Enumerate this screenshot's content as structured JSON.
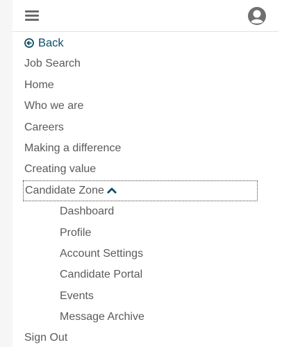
{
  "header": {
    "menu_icon": "hamburger-menu-icon",
    "user_icon": "user-avatar-icon"
  },
  "menu": {
    "back_label": "Back",
    "back_icon": "circle-arrow-left-icon",
    "items": [
      "Job Search",
      "Home",
      "Who we are",
      "Careers",
      "Making a difference",
      "Creating value"
    ],
    "candidate_zone": {
      "label": "Candidate Zone",
      "icon": "chevron-up-icon",
      "expanded": true,
      "subitems": [
        "Dashboard",
        "Profile",
        "Account Settings",
        "Candidate Portal",
        "Events",
        "Message Archive"
      ]
    },
    "sign_out_label": "Sign Out"
  },
  "colors": {
    "accent": "#0e5066",
    "text": "#5a5a5a",
    "icon": "#6a6a6a"
  }
}
